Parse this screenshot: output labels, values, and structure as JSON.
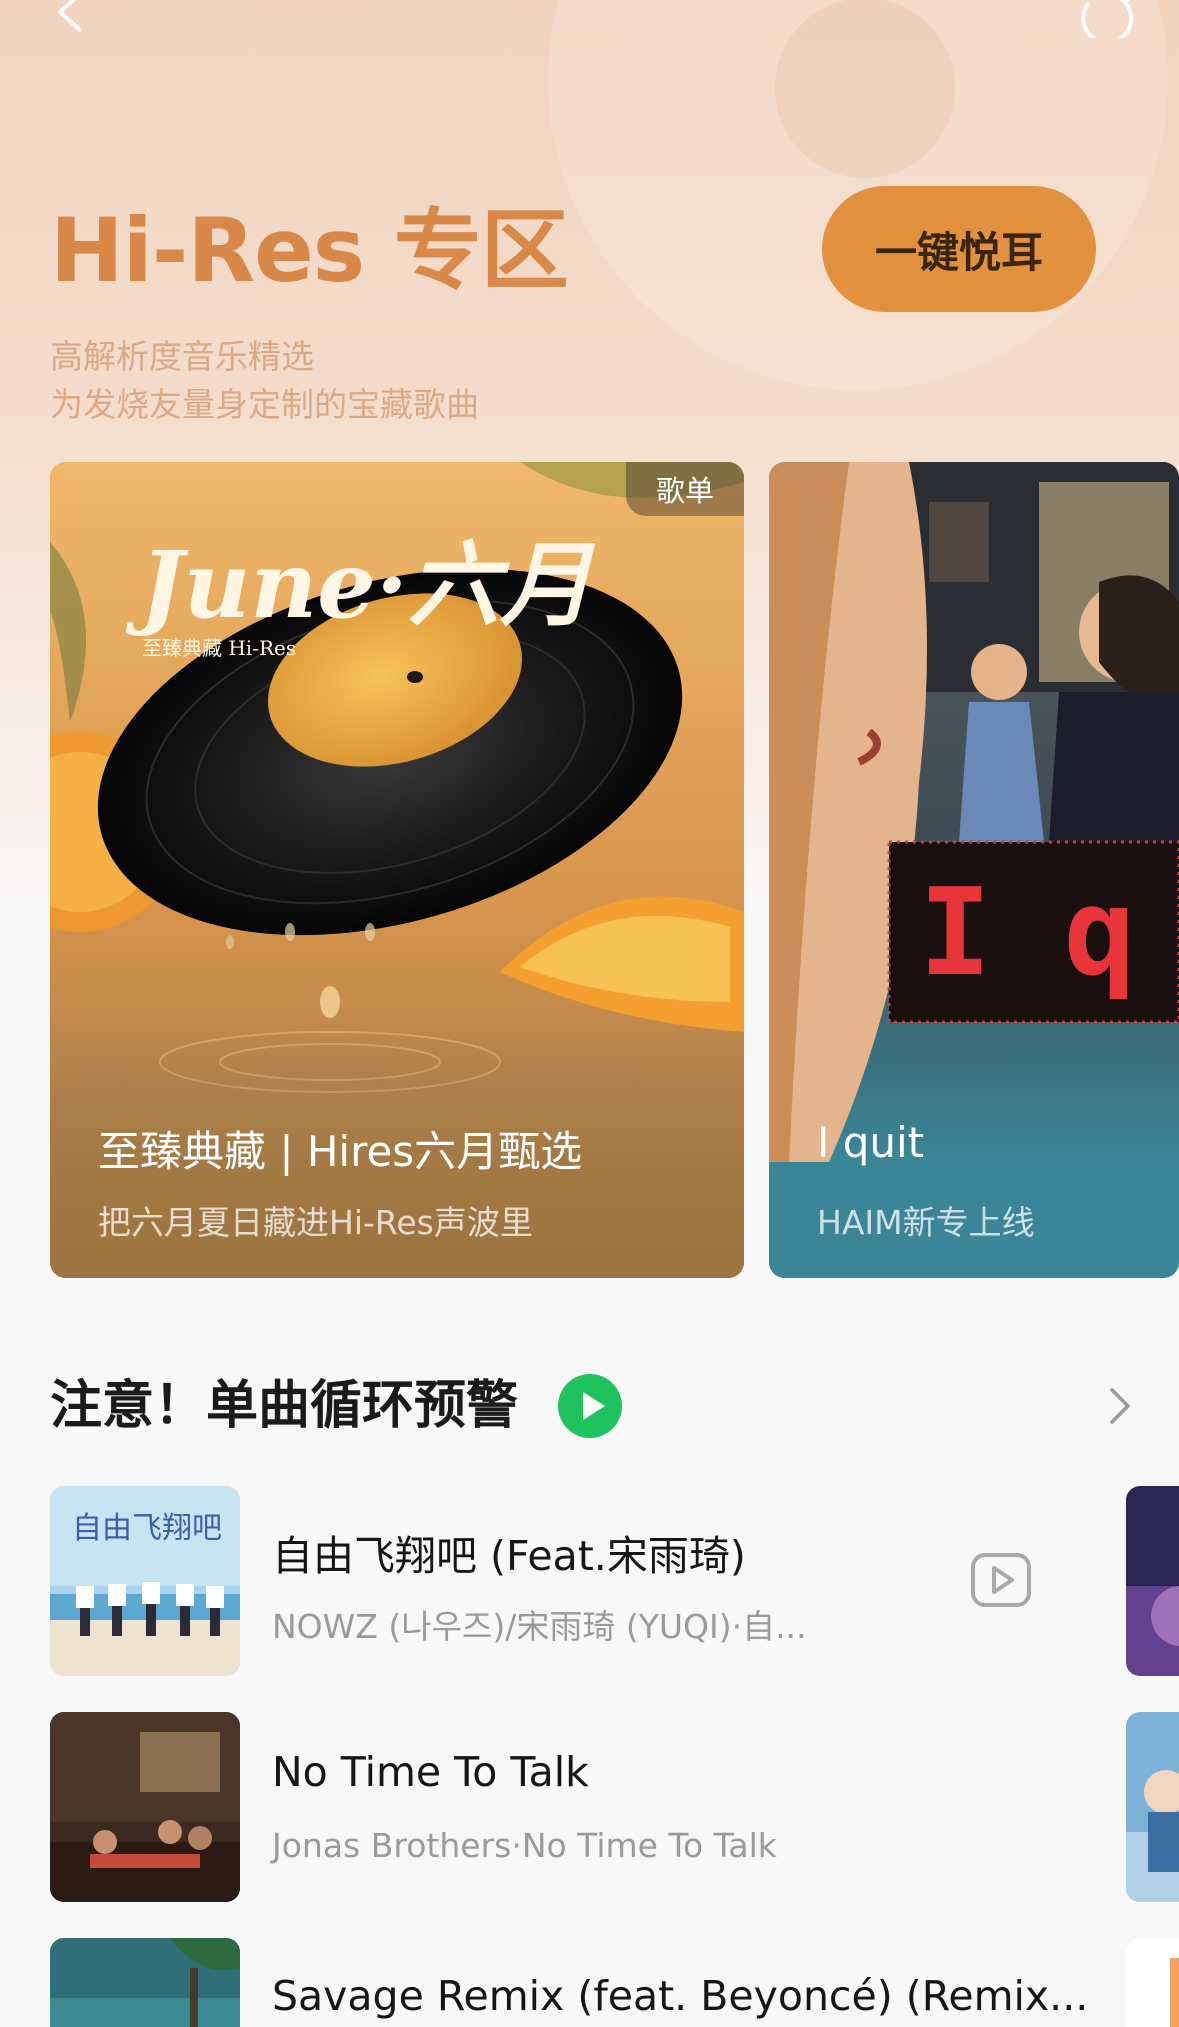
{
  "header": {
    "title": "Hi-Res 专区",
    "subtitle_line1": "高解析度音乐精选",
    "subtitle_line2": "为发烧友量身定制的宝藏歌曲",
    "cta_label": "一键悦耳",
    "back_icon": "chevron-left-icon",
    "refresh_icon": "refresh-icon"
  },
  "featured": [
    {
      "badge": "歌单",
      "art_title": "June·六月",
      "art_subtitle": "至臻典藏 Hi-Res",
      "title": "至臻典藏 | Hires六月甄选",
      "subtitle": "把六月夏日藏进Hi-Res声波里"
    },
    {
      "title": "I quit",
      "subtitle": "HAIM新专上线",
      "sign_text": "I q"
    }
  ],
  "section": {
    "title": "注意！单曲循环预警",
    "play_icon": "play-icon",
    "more_icon": "chevron-right-icon"
  },
  "songs": [
    {
      "title": "自由飞翔吧 (Feat.宋雨琦)",
      "meta": "NOWZ (나우즈)/宋雨琦 (YUQI)·自...",
      "cover_text": "自由飞翔吧",
      "has_mv": true
    },
    {
      "title": "No Time To Talk",
      "meta": "Jonas Brothers·No Time To Talk",
      "has_mv": false
    },
    {
      "title": "Savage Remix (feat. Beyoncé) (Remix...",
      "meta": "",
      "has_mv": false
    }
  ],
  "colors": {
    "accent": "#d8894a",
    "cta_bg": "#e2913f",
    "play_green": "#1fc35d"
  }
}
